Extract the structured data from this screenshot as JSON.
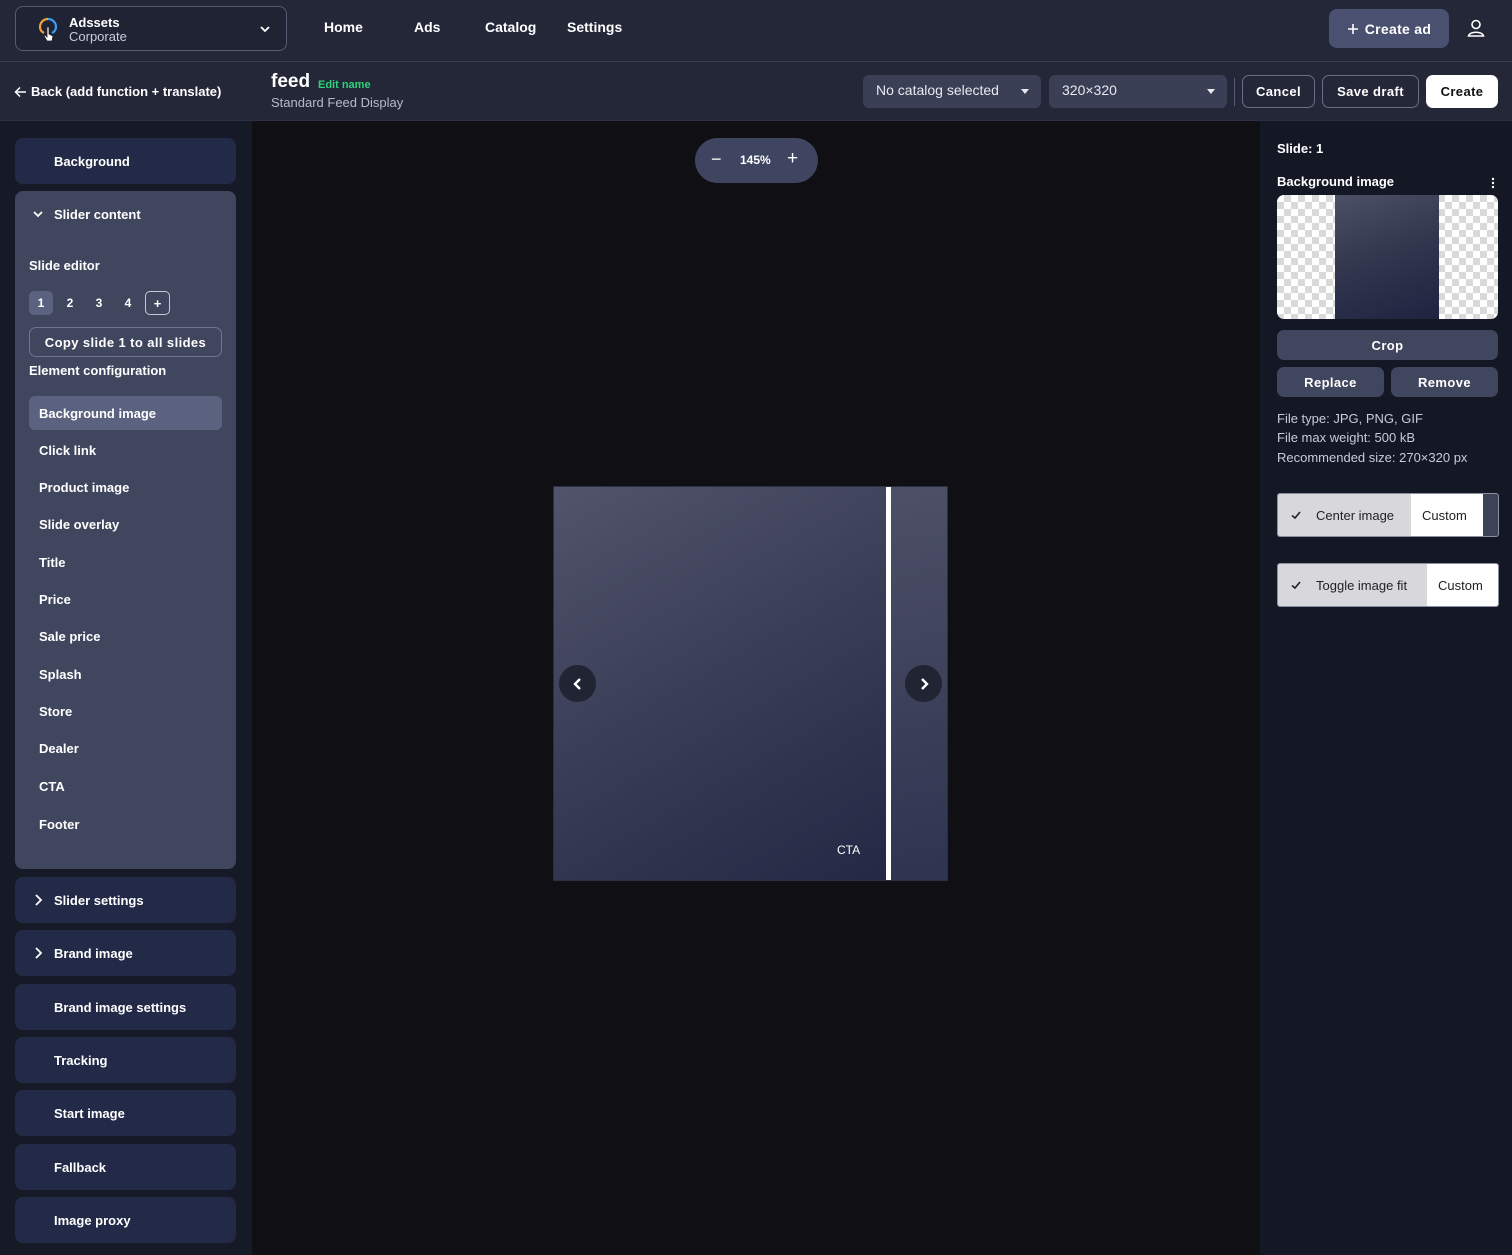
{
  "org": {
    "name": "Adssets",
    "sub": "Corporate"
  },
  "nav": [
    "Home",
    "Ads",
    "Catalog",
    "Settings"
  ],
  "header": {
    "create_ad": "Create ad"
  },
  "subbar": {
    "back": "Back (add function + translate)",
    "ad_name": "feed",
    "edit_name": "Edit name",
    "ad_type": "Standard Feed Display",
    "catalog_select": "No catalog selected",
    "size_select": "320×320",
    "cancel": "Cancel",
    "save_draft": "Save draft",
    "create": "Create"
  },
  "sidebar": {
    "background": "Background",
    "slider_content": "Slider content",
    "slide_editor": "Slide editor",
    "slides": [
      "1",
      "2",
      "3",
      "4"
    ],
    "add_slide": "+",
    "copy_slide": "Copy slide 1 to all slides",
    "element_config": "Element configuration",
    "elements": [
      "Background image",
      "Click link",
      "Product image",
      "Slide overlay",
      "Title",
      "Price",
      "Sale price",
      "Splash",
      "Store",
      "Dealer",
      "CTA",
      "Footer"
    ],
    "sections": [
      "Slider settings",
      "Brand image",
      "Brand image settings",
      "Tracking",
      "Start image",
      "Fallback",
      "Image proxy"
    ]
  },
  "canvas": {
    "zoom_minus": "−",
    "zoom": "145%",
    "zoom_plus": "+",
    "cta": "CTA"
  },
  "right": {
    "slide": "Slide: 1",
    "bg_image": "Background image",
    "crop": "Crop",
    "replace": "Replace",
    "remove": "Remove",
    "file_type": "File type: JPG, PNG, GIF",
    "file_weight": "File max weight: 500 kB",
    "rec_size": "Recommended size: 270×320 px",
    "center_image": "Center image",
    "custom1": "Custom",
    "toggle_fit": "Toggle image fit",
    "custom2": "Custom"
  },
  "colors": {
    "accent_green": "#2bd37a",
    "panel": "#40465e",
    "card": "#232a47"
  }
}
